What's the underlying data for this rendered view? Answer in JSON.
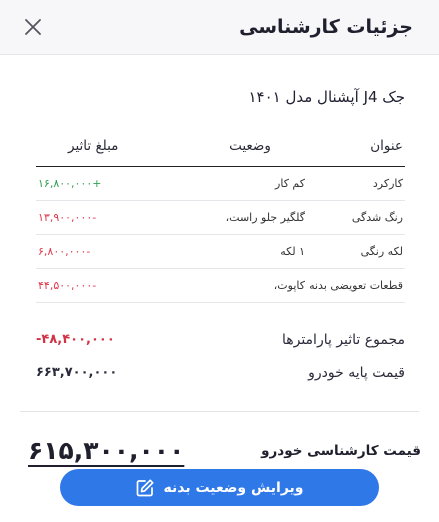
{
  "header": {
    "title": "جزئیات کارشناسی"
  },
  "car": {
    "name": "جک J4 آپشنال مدل ۱۴۰۱"
  },
  "table": {
    "headers": {
      "title": "عنوان",
      "status": "وضعیت",
      "amount": "مبلغ تاثیر"
    },
    "rows": [
      {
        "title": "کارکرد",
        "status": "کم کار",
        "amount": "+۱۶,۸۰۰,۰۰۰"
      },
      {
        "title": "رنگ شدگی",
        "status": "گلگیر جلو راست،",
        "amount": "-۱۳,۹۰۰,۰۰۰"
      },
      {
        "title": "لکه رنگی",
        "status": "۱ لکه",
        "amount": "-۶,۸۰۰,۰۰۰"
      },
      {
        "title": "قطعات تعویضی بدنه",
        "status": "کاپوت،",
        "amount": "-۴۴,۵۰۰,۰۰۰"
      }
    ]
  },
  "summary": {
    "params_label": "مجموع تاثیر پارامترها",
    "params_value": "-۴۸,۴۰۰,۰۰۰",
    "base_label": "قیمت پایه خودرو",
    "base_value": "۶۶۳,۷۰۰,۰۰۰"
  },
  "final": {
    "label": "قیمت کارشناسی خودرو",
    "value": "۶۱۵,۳۰۰,۰۰۰"
  },
  "edit_button": {
    "label": "ویرایش وضعیت بدنه"
  },
  "colors": {
    "accent": "#2f78e8",
    "positive": "#2e9e4f",
    "negative": "#e0394a"
  },
  "icons": {
    "close": "close-icon",
    "edit": "pencil-square-icon"
  }
}
